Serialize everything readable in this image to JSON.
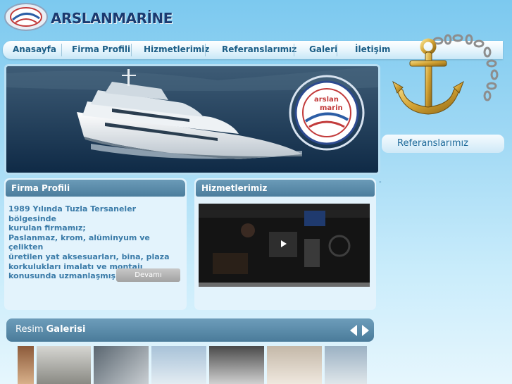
{
  "brand": {
    "name": "ARSLANMARİNE"
  },
  "nav": {
    "items": [
      {
        "label": "Anasayfa"
      },
      {
        "label": "Firma Profili"
      },
      {
        "label": "Hizmetlerimiz"
      },
      {
        "label": "Referanslarımız"
      },
      {
        "label": "Galeri"
      },
      {
        "label": "İletişim"
      }
    ]
  },
  "hero": {
    "badge_top": "arslan",
    "badge_bottom": "marin"
  },
  "firma": {
    "title": "Firma Profili",
    "lines": [
      "1989 Yılında Tuzla Tersaneler bölgesinde",
      "kurulan firmamız;",
      "Paslanmaz, krom, alüminyum ve çelikten",
      "üretilen yat aksesuarları, bina, plaza",
      "korkulukları imalatı ve montajı",
      "konusunda uzmanlaşmış tır."
    ],
    "more_label": "Devamı"
  },
  "hizmet": {
    "title": "Hizmetlerimiz"
  },
  "side": {
    "ref_label": "Referanslarımız",
    "dash": "-"
  },
  "gallery": {
    "title_prefix": "Resim",
    "title_bold": "Galerisi"
  },
  "icons": [
    "anchor-icon",
    "play-icon",
    "arrow-left-icon",
    "arrow-right-icon",
    "logo-emblem-icon"
  ],
  "colors": {
    "nav_text": "#1c5e86",
    "panel_head": "#4c7d9c",
    "body_text": "#3a7ba8",
    "panel_bg": "#e3f3fc"
  }
}
